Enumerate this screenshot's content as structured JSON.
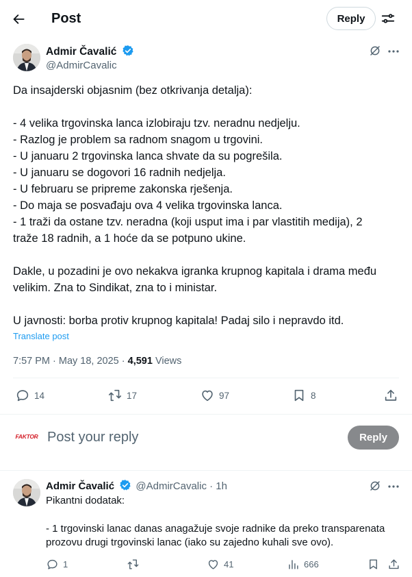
{
  "header": {
    "title": "Post",
    "reply_label": "Reply"
  },
  "post": {
    "author_name": "Admir Čavalić",
    "handle": "@AdmirCavalic",
    "lines": [
      "Da insajderski objasnim (bez otkrivanja detalja):",
      "- 4 velika trgovinska lanca izlobiraju tzv. neradnu nedjelju.",
      "- Razlog je problem sa radnom snagom u trgovini.",
      "- U januaru 2 trgovinska lanca shvate da su pogrešila.",
      "- U januaru se dogovori 16 radnih nedjelja.",
      "- U februaru se pripreme zakonska rješenja.",
      "- Do maja se posvađaju ova 4 velika trgovinska lanca.",
      "- 1 traži da ostane tzv. neradna (koji usput ima i par vlastitih medija), 2",
      "traže 18 radnih, a 1 hoće da se potpuno ukine.",
      "Dakle, u pozadini je ovo nekakva igranka krupnog kapitala i drama među",
      "velikim. Zna to Sindikat, zna to i ministar.",
      "U javnosti: borba protiv krupnog kapitala! Padaj silo i nepravdo itd."
    ],
    "translate_label": "Translate post",
    "time": "7:57 PM · May 18, 2025 · ",
    "views_count": "4,591",
    "views_label": " Views",
    "stats": {
      "replies": "14",
      "reposts": "17",
      "likes": "97",
      "bookmarks": "8"
    }
  },
  "composer": {
    "avatar_text": "FAKTOR",
    "placeholder": "Post your reply",
    "reply_button": "Reply"
  },
  "reply": {
    "author_name": "Admir Čavalić",
    "handle_time": "@AdmirCavalic · 1h",
    "lines": [
      "Pikantni dodatak:",
      "- 1 trgovinski lanac danas anagažuje svoje radnike da preko transparenata",
      "prozovu drugi trgovinski lanac (iako su zajedno kuhali sve ovo)."
    ],
    "stats": {
      "replies": "1",
      "likes": "41",
      "views": "666"
    }
  },
  "colors": {
    "verified": "#1d9bf0",
    "link": "#1d9bf0",
    "disabled_button": "#87898c",
    "faktor_red": "#d4202a"
  }
}
